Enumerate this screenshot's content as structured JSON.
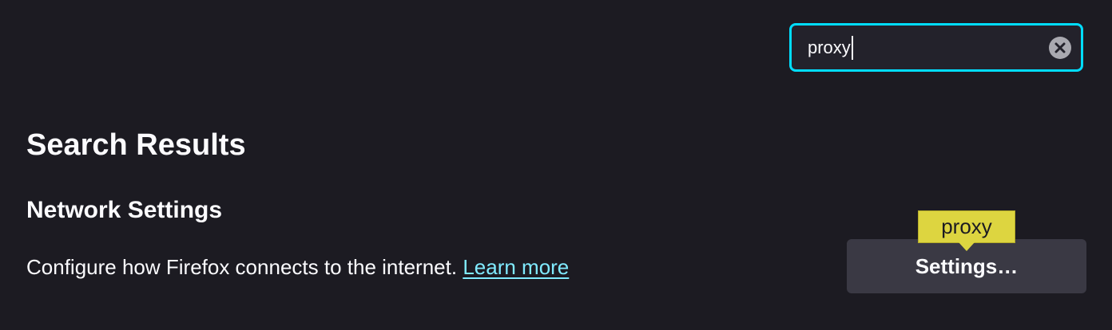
{
  "search": {
    "value": "proxy",
    "clear_icon": "close-circle-icon"
  },
  "main": {
    "title": "Search Results",
    "section": {
      "title": "Network Settings",
      "description": "Configure how Firefox connects to the internet.",
      "learn_more": "Learn more",
      "settings_button": "Settings…",
      "highlight_label": "proxy"
    }
  },
  "colors": {
    "background": "#1c1b22",
    "accent_focus": "#00ddff",
    "link": "#80ebff",
    "highlight": "#ddd540",
    "button": "#3a3944"
  }
}
